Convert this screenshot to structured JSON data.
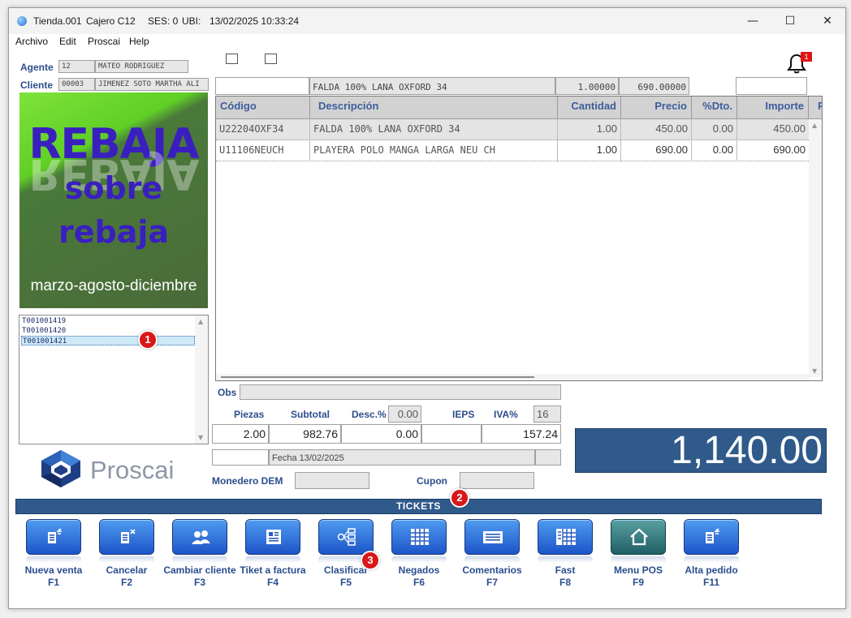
{
  "titlebar": {
    "store": "Tienda.001",
    "cashier": "Cajero C12",
    "ses": "SES: 0",
    "ubi": "UBI:",
    "datetime": "13/02/2025 10:33:24",
    "minimize": "—",
    "maximize": "☐",
    "close": "✕"
  },
  "menu": {
    "items": [
      "Archivo",
      "Edit",
      "Proscai",
      "Help"
    ]
  },
  "agent": {
    "label": "Agente",
    "code": "12",
    "name": "MATEO RODRIGUEZ"
  },
  "client": {
    "label": "Cliente",
    "code": "00003",
    "name": "JIMENEZ SOTO MARTHA ALI"
  },
  "notification": {
    "count": "1"
  },
  "current_item": {
    "description": "FALDA 100% LANA OXFORD 34",
    "quantity": "1.00000",
    "price": "690.00000"
  },
  "promo": {
    "title": "REBAJA",
    "line2": "sobre",
    "line3": "rebaja",
    "footer": "marzo-agosto-diciembre"
  },
  "tickets": [
    "T001001419",
    "T001001420",
    "T001001421"
  ],
  "grid": {
    "headers": [
      "Código",
      "Descripción",
      "Cantidad",
      "Precio",
      "%Dto.",
      "Importe",
      "P"
    ],
    "rows": [
      {
        "code": "U22204OXF34",
        "description": "FALDA 100% LANA OXFORD 34",
        "quantity": "1.00",
        "price": "450.00",
        "discount": "0.00",
        "amount": "450.00"
      },
      {
        "code": "U11106NEUCH",
        "description": "PLAYERA POLO MANGA LARGA NEU CH",
        "quantity": "1.00",
        "price": "690.00",
        "discount": "0.00",
        "amount": "690.00"
      }
    ]
  },
  "summary": {
    "obs_label": "Obs",
    "pieces_label": "Piezas",
    "subtotal_label": "Subtotal",
    "desc_label": "Desc.%",
    "desc_pct": "0.00",
    "ieps_label": "IEPS",
    "iva_label": "IVA%",
    "iva_pct": "16",
    "pieces": "2.00",
    "subtotal": "982.76",
    "discount": "0.00",
    "ieps": "",
    "iva": "157.24",
    "date_text": "Fecha 13/02/2025",
    "wallet_label": "Monedero DEM",
    "coupon_label": "Cupon",
    "total": "1,140.00"
  },
  "brand": {
    "name": "Proscai"
  },
  "tickets_bar": {
    "label": "TICKETS"
  },
  "annotations": [
    "1",
    "2",
    "3"
  ],
  "buttons": [
    {
      "label": "Nueva venta",
      "key": "F1",
      "icon": "new-sale-icon"
    },
    {
      "label": "Cancelar",
      "key": "F2",
      "icon": "cancel-icon"
    },
    {
      "label": "Cambiar cliente",
      "key": "F3",
      "icon": "change-client-icon"
    },
    {
      "label": "Tiket a factura",
      "key": "F4",
      "icon": "invoice-icon"
    },
    {
      "label": "Clasificar",
      "key": "F5",
      "icon": "classify-icon"
    },
    {
      "label": "Negados",
      "key": "F6",
      "icon": "denied-icon"
    },
    {
      "label": "Comentarios",
      "key": "F7",
      "icon": "comments-icon"
    },
    {
      "label": "Fast",
      "key": "F8",
      "icon": "fast-icon"
    },
    {
      "label": "Menu POS",
      "key": "F9",
      "icon": "home-icon"
    },
    {
      "label": "Alta pedido",
      "key": "F11",
      "icon": "new-order-icon"
    }
  ],
  "colors": {
    "accent": "#2f5a8a",
    "label_blue": "#2a4e8e",
    "promo_text": "#3a1fbf",
    "badge_red": "#d81818"
  }
}
